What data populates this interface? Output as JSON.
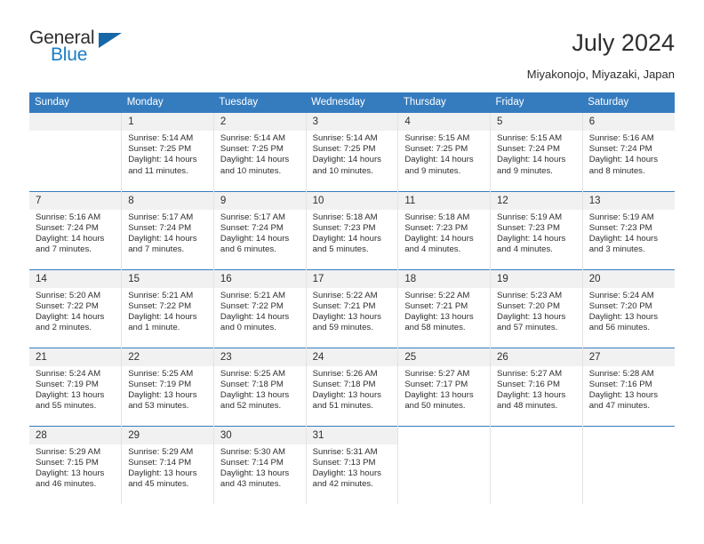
{
  "brand": {
    "name_top": "General",
    "name_bottom": "Blue",
    "triangle_color": "#1668a8",
    "blue_color": "#1a7dc4"
  },
  "header": {
    "title": "July 2024",
    "subtitle": "Miyakonojo, Miyazaki, Japan"
  },
  "theme": {
    "header_row_color": "#357cbf",
    "daynum_band_color": "#f1f1f1",
    "text_color": "#2e2e2e"
  },
  "calendar": {
    "weekday_headers": [
      "Sunday",
      "Monday",
      "Tuesday",
      "Wednesday",
      "Thursday",
      "Friday",
      "Saturday"
    ],
    "weeks": [
      [
        {
          "day": "",
          "lines": []
        },
        {
          "day": "1",
          "lines": [
            "Sunrise: 5:14 AM",
            "Sunset: 7:25 PM",
            "Daylight: 14 hours",
            "and 11 minutes."
          ]
        },
        {
          "day": "2",
          "lines": [
            "Sunrise: 5:14 AM",
            "Sunset: 7:25 PM",
            "Daylight: 14 hours",
            "and 10 minutes."
          ]
        },
        {
          "day": "3",
          "lines": [
            "Sunrise: 5:14 AM",
            "Sunset: 7:25 PM",
            "Daylight: 14 hours",
            "and 10 minutes."
          ]
        },
        {
          "day": "4",
          "lines": [
            "Sunrise: 5:15 AM",
            "Sunset: 7:25 PM",
            "Daylight: 14 hours",
            "and 9 minutes."
          ]
        },
        {
          "day": "5",
          "lines": [
            "Sunrise: 5:15 AM",
            "Sunset: 7:24 PM",
            "Daylight: 14 hours",
            "and 9 minutes."
          ]
        },
        {
          "day": "6",
          "lines": [
            "Sunrise: 5:16 AM",
            "Sunset: 7:24 PM",
            "Daylight: 14 hours",
            "and 8 minutes."
          ]
        }
      ],
      [
        {
          "day": "7",
          "lines": [
            "Sunrise: 5:16 AM",
            "Sunset: 7:24 PM",
            "Daylight: 14 hours",
            "and 7 minutes."
          ]
        },
        {
          "day": "8",
          "lines": [
            "Sunrise: 5:17 AM",
            "Sunset: 7:24 PM",
            "Daylight: 14 hours",
            "and 7 minutes."
          ]
        },
        {
          "day": "9",
          "lines": [
            "Sunrise: 5:17 AM",
            "Sunset: 7:24 PM",
            "Daylight: 14 hours",
            "and 6 minutes."
          ]
        },
        {
          "day": "10",
          "lines": [
            "Sunrise: 5:18 AM",
            "Sunset: 7:23 PM",
            "Daylight: 14 hours",
            "and 5 minutes."
          ]
        },
        {
          "day": "11",
          "lines": [
            "Sunrise: 5:18 AM",
            "Sunset: 7:23 PM",
            "Daylight: 14 hours",
            "and 4 minutes."
          ]
        },
        {
          "day": "12",
          "lines": [
            "Sunrise: 5:19 AM",
            "Sunset: 7:23 PM",
            "Daylight: 14 hours",
            "and 4 minutes."
          ]
        },
        {
          "day": "13",
          "lines": [
            "Sunrise: 5:19 AM",
            "Sunset: 7:23 PM",
            "Daylight: 14 hours",
            "and 3 minutes."
          ]
        }
      ],
      [
        {
          "day": "14",
          "lines": [
            "Sunrise: 5:20 AM",
            "Sunset: 7:22 PM",
            "Daylight: 14 hours",
            "and 2 minutes."
          ]
        },
        {
          "day": "15",
          "lines": [
            "Sunrise: 5:21 AM",
            "Sunset: 7:22 PM",
            "Daylight: 14 hours",
            "and 1 minute."
          ]
        },
        {
          "day": "16",
          "lines": [
            "Sunrise: 5:21 AM",
            "Sunset: 7:22 PM",
            "Daylight: 14 hours",
            "and 0 minutes."
          ]
        },
        {
          "day": "17",
          "lines": [
            "Sunrise: 5:22 AM",
            "Sunset: 7:21 PM",
            "Daylight: 13 hours",
            "and 59 minutes."
          ]
        },
        {
          "day": "18",
          "lines": [
            "Sunrise: 5:22 AM",
            "Sunset: 7:21 PM",
            "Daylight: 13 hours",
            "and 58 minutes."
          ]
        },
        {
          "day": "19",
          "lines": [
            "Sunrise: 5:23 AM",
            "Sunset: 7:20 PM",
            "Daylight: 13 hours",
            "and 57 minutes."
          ]
        },
        {
          "day": "20",
          "lines": [
            "Sunrise: 5:24 AM",
            "Sunset: 7:20 PM",
            "Daylight: 13 hours",
            "and 56 minutes."
          ]
        }
      ],
      [
        {
          "day": "21",
          "lines": [
            "Sunrise: 5:24 AM",
            "Sunset: 7:19 PM",
            "Daylight: 13 hours",
            "and 55 minutes."
          ]
        },
        {
          "day": "22",
          "lines": [
            "Sunrise: 5:25 AM",
            "Sunset: 7:19 PM",
            "Daylight: 13 hours",
            "and 53 minutes."
          ]
        },
        {
          "day": "23",
          "lines": [
            "Sunrise: 5:25 AM",
            "Sunset: 7:18 PM",
            "Daylight: 13 hours",
            "and 52 minutes."
          ]
        },
        {
          "day": "24",
          "lines": [
            "Sunrise: 5:26 AM",
            "Sunset: 7:18 PM",
            "Daylight: 13 hours",
            "and 51 minutes."
          ]
        },
        {
          "day": "25",
          "lines": [
            "Sunrise: 5:27 AM",
            "Sunset: 7:17 PM",
            "Daylight: 13 hours",
            "and 50 minutes."
          ]
        },
        {
          "day": "26",
          "lines": [
            "Sunrise: 5:27 AM",
            "Sunset: 7:16 PM",
            "Daylight: 13 hours",
            "and 48 minutes."
          ]
        },
        {
          "day": "27",
          "lines": [
            "Sunrise: 5:28 AM",
            "Sunset: 7:16 PM",
            "Daylight: 13 hours",
            "and 47 minutes."
          ]
        }
      ],
      [
        {
          "day": "28",
          "lines": [
            "Sunrise: 5:29 AM",
            "Sunset: 7:15 PM",
            "Daylight: 13 hours",
            "and 46 minutes."
          ]
        },
        {
          "day": "29",
          "lines": [
            "Sunrise: 5:29 AM",
            "Sunset: 7:14 PM",
            "Daylight: 13 hours",
            "and 45 minutes."
          ]
        },
        {
          "day": "30",
          "lines": [
            "Sunrise: 5:30 AM",
            "Sunset: 7:14 PM",
            "Daylight: 13 hours",
            "and 43 minutes."
          ]
        },
        {
          "day": "31",
          "lines": [
            "Sunrise: 5:31 AM",
            "Sunset: 7:13 PM",
            "Daylight: 13 hours",
            "and 42 minutes."
          ]
        },
        {
          "day": null,
          "lines": []
        },
        {
          "day": null,
          "lines": []
        },
        {
          "day": null,
          "lines": []
        }
      ]
    ]
  }
}
